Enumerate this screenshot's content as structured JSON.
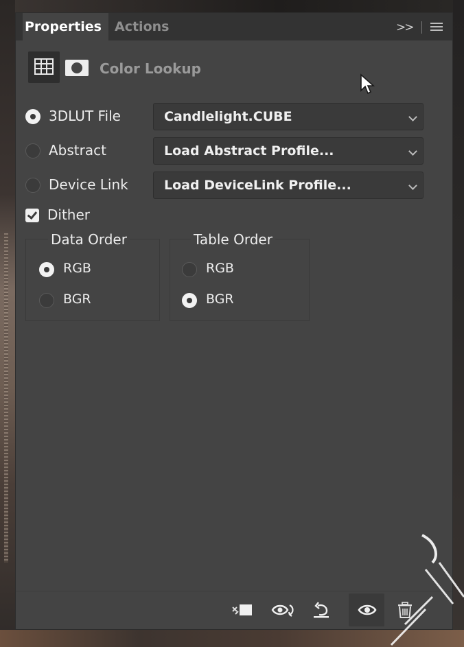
{
  "tabs": {
    "properties": "Properties",
    "actions": "Actions"
  },
  "panel": {
    "title": "Color Lookup",
    "icons": [
      "grid-lut-icon",
      "mask-icon"
    ]
  },
  "lookup_options": [
    {
      "label": "3DLUT File",
      "selected": true,
      "dropdown_value": "Candlelight.CUBE"
    },
    {
      "label": "Abstract",
      "selected": false,
      "dropdown_value": "Load Abstract Profile..."
    },
    {
      "label": "Device Link",
      "selected": false,
      "dropdown_value": "Load DeviceLink Profile..."
    }
  ],
  "dither": {
    "label": "Dither",
    "checked": true
  },
  "data_order": {
    "title": "Data Order",
    "options": [
      {
        "label": "RGB",
        "selected": true
      },
      {
        "label": "BGR",
        "selected": false
      }
    ]
  },
  "table_order": {
    "title": "Table Order",
    "options": [
      {
        "label": "RGB",
        "selected": false
      },
      {
        "label": "BGR",
        "selected": true
      }
    ]
  },
  "footer_icons": [
    "clip-to-layer-icon",
    "view-previous-state-icon",
    "reset-icon",
    "visibility-eye-icon",
    "delete-trash-icon"
  ],
  "colors": {
    "panel_bg": "#444444",
    "tabbar_bg": "#333333",
    "dropdown_bg": "#3a3a3a",
    "text": "#ededed",
    "inactive_tab": "#8e8e8e"
  }
}
